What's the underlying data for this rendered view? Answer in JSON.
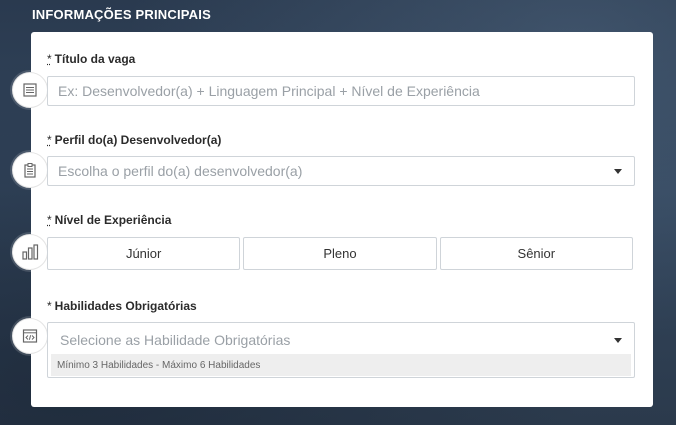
{
  "section": {
    "title": "INFORMAÇÕES PRINCIPAIS"
  },
  "fields": {
    "titulo": {
      "required_mark": "*",
      "label": "Título da vaga",
      "placeholder": "Ex: Desenvolvedor(a) + Linguagem Principal + Nível de Experiência",
      "icon": "document-icon"
    },
    "perfil": {
      "required_mark": "*",
      "label": "Perfil do(a) Desenvolvedor(a)",
      "placeholder": "Escolha o perfil do(a) desenvolvedor(a)",
      "icon": "clipboard-icon"
    },
    "nivel": {
      "required_mark": "*",
      "label": "Nível de Experiência",
      "options": [
        "Júnior",
        "Pleno",
        "Sênior"
      ],
      "icon": "bar-chart-icon"
    },
    "habilidades": {
      "required_mark": "*",
      "label": "Habilidades Obrigatórias",
      "placeholder": "Selecione as Habilidade Obrigatórias",
      "hint": "Mínimo 3 Habilidades - Máximo 6 Habilidades",
      "icon": "code-window-icon"
    }
  },
  "colors": {
    "background": "#2a3a4f",
    "card": "#ffffff",
    "border": "#cfd4d9",
    "placeholder": "#9aa0a6"
  }
}
